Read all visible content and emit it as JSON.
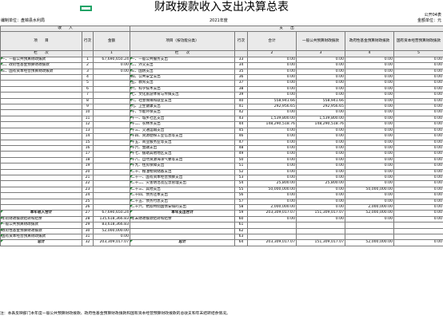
{
  "title": "财政拨款收入支出决算总表",
  "meta": {
    "unit_left": "编制单位：",
    "unit_name": "盘锦县水利局",
    "year": "2021年度",
    "form_no": "公开04表",
    "unit_right": "金额单位：元"
  },
  "headers": {
    "income": "收　　入",
    "expense": "支　　出",
    "item": "项　　目",
    "row_no": "行次",
    "amount": "金额",
    "item_by_function": "项目（按功能分类）",
    "total": "合计",
    "general_budget": "一般公共预算财政拨款",
    "gov_fund": "政府性基金预算财政拨款",
    "state_capital": "国有资本经营预算财政拨款",
    "lan_ci": "栏　　次",
    "col_nums": [
      "1",
      "2",
      "3",
      "4",
      "5"
    ]
  },
  "rows": [
    {
      "ln": "一、一般公共预算财政拨款",
      "li": "1",
      "la": "67,690,650.24",
      "rn": "一、一般公共服务支出",
      "ri": "33",
      "t": "0.00",
      "g": "0.00",
      "f": "0.00",
      "s": "0.00"
    },
    {
      "ln": "二、政府性基金预算财政拨款",
      "li": "2",
      "la": "0.00",
      "rn": "二、外交支出",
      "ri": "34",
      "t": "0.00",
      "g": "0.00",
      "f": "0.00",
      "s": "0.00"
    },
    {
      "ln": "三、国有资本经营预算财政拨款",
      "li": "3",
      "la": "0.00",
      "rn": "三、国防支出",
      "ri": "35",
      "t": "0.00",
      "g": "0.00",
      "f": "0.00",
      "s": "0.00"
    },
    {
      "ln": "",
      "li": "4",
      "la": "",
      "rn": "四、公共安全支出",
      "ri": "36",
      "t": "0.00",
      "g": "0.00",
      "f": "0.00",
      "s": "0.00"
    },
    {
      "ln": "",
      "li": "5",
      "la": "",
      "rn": "五、教育支出",
      "ri": "37",
      "t": "0.00",
      "g": "0.00",
      "f": "0.00",
      "s": "0.00"
    },
    {
      "ln": "",
      "li": "6",
      "la": "",
      "rn": "六、科学技术支出",
      "ri": "38",
      "t": "0.00",
      "g": "0.00",
      "f": "0.00",
      "s": "0.00"
    },
    {
      "ln": "",
      "li": "7",
      "la": "",
      "rn": "七、文化旅游体育与传媒支出",
      "ri": "39",
      "t": "0.00",
      "g": "0.00",
      "f": "0.00",
      "s": "0.00"
    },
    {
      "ln": "",
      "li": "8",
      "la": "",
      "rn": "八、社会保障和就业支出",
      "ri": "40",
      "t": "558,941.66",
      "g": "558,941.66",
      "f": "0.00",
      "s": "0.00"
    },
    {
      "ln": "",
      "li": "9",
      "la": "",
      "rn": "九、卫生健康支出",
      "ri": "41",
      "t": "292,956.65",
      "g": "292,956.65",
      "f": "0.00",
      "s": "0.00"
    },
    {
      "ln": "",
      "li": "10",
      "la": "",
      "rn": "十、节能环保支出",
      "ri": "42",
      "t": "0.00",
      "g": "0.00",
      "f": "0.00",
      "s": "0.00"
    },
    {
      "ln": "",
      "li": "11",
      "la": "",
      "rn": "十一、城乡社区支出",
      "ri": "43",
      "t": "1,539,800.00",
      "g": "1,539,800.00",
      "f": "0.00",
      "s": "0.00"
    },
    {
      "ln": "",
      "li": "12",
      "la": "",
      "rn": "十二、农林水支出",
      "ri": "44",
      "t": "148,290,518.76",
      "g": "148,290,518.76",
      "f": "0.00",
      "s": "0.00"
    },
    {
      "ln": "",
      "li": "13",
      "la": "",
      "rn": "十三、交通运输支出",
      "ri": "45",
      "t": "0.00",
      "g": "0.00",
      "f": "0.00",
      "s": "0.00"
    },
    {
      "ln": "",
      "li": "14",
      "la": "",
      "rn": "十四、资源勘探工业信息等支出",
      "ri": "46",
      "t": "0.00",
      "g": "0.00",
      "f": "0.00",
      "s": "0.00"
    },
    {
      "ln": "",
      "li": "15",
      "la": "",
      "rn": "十五、商业服务业等支出",
      "ri": "47",
      "t": "0.00",
      "g": "0.00",
      "f": "0.00",
      "s": "0.00"
    },
    {
      "ln": "",
      "li": "16",
      "la": "",
      "rn": "十六、金融支出",
      "ri": "48",
      "t": "0.00",
      "g": "0.00",
      "f": "0.00",
      "s": "0.00"
    },
    {
      "ln": "",
      "li": "17",
      "la": "",
      "rn": "十七、援助其他地区支出",
      "ri": "49",
      "t": "0.00",
      "g": "0.00",
      "f": "0.00",
      "s": "0.00"
    },
    {
      "ln": "",
      "li": "18",
      "la": "",
      "rn": "十八、自然资源海洋气象等支出",
      "ri": "50",
      "t": "0.00",
      "g": "0.00",
      "f": "0.00",
      "s": "0.00"
    },
    {
      "ln": "",
      "li": "19",
      "la": "",
      "rn": "十九、住房保障支出",
      "ri": "51",
      "t": "0.00",
      "g": "0.00",
      "f": "0.00",
      "s": "0.00"
    },
    {
      "ln": "",
      "li": "20",
      "la": "",
      "rn": "二十、粮油物资储备支出",
      "ri": "52",
      "t": "0.00",
      "g": "0.00",
      "f": "0.00",
      "s": "0.00"
    },
    {
      "ln": "",
      "li": "21",
      "la": "",
      "rn": "二十一、国有资本经营预算支出",
      "ri": "53",
      "t": "0.00",
      "g": "0.00",
      "f": "0.00",
      "s": "0.00"
    },
    {
      "ln": "",
      "li": "22",
      "la": "",
      "rn": "二十二、灾害防治及应急管理支出",
      "ri": "54",
      "t": "25,800.00",
      "g": "25,800.00",
      "f": "0.00",
      "s": "0.00"
    },
    {
      "ln": "",
      "li": "23",
      "la": "",
      "rn": "二十三、其他支出",
      "ri": "55",
      "t": "50,000,000.00",
      "g": "0.00",
      "f": "50,000,000.00",
      "s": "0.00"
    },
    {
      "ln": "",
      "li": "24",
      "la": "",
      "rn": "二十四、债务还本支出",
      "ri": "56",
      "t": "0.00",
      "g": "0.00",
      "f": "0.00",
      "s": "0.00"
    },
    {
      "ln": "",
      "li": "25",
      "la": "",
      "rn": "二十五、债务付息支出",
      "ri": "57",
      "t": "0.00",
      "g": "0.00",
      "f": "0.00",
      "s": "0.00"
    },
    {
      "ln": "",
      "li": "26",
      "la": "",
      "rn": "二十六、抗疫特别国债安排的支出",
      "ri": "58",
      "t": "2,000,000.00",
      "g": "0.00",
      "f": "2,000,000.00",
      "s": "0.00"
    }
  ],
  "summary_rows": [
    {
      "ln": "本年收入合计",
      "li": "27",
      "la": "67,690,650.24",
      "rn": "本年支出合计",
      "ri": "59",
      "t": "203,309,017.07",
      "g": "151,309,017.07",
      "f": "52,000,000.00",
      "s": "0.00",
      "bold": true
    },
    {
      "ln": "年初财政拨款结转和结余",
      "li": "28",
      "la": "135,618,366.83",
      "rn": "年末财政拨款结转和结余",
      "ri": "60",
      "t": "0.00",
      "g": "0.00",
      "f": "0.00",
      "s": "0.00",
      "bold": false
    },
    {
      "ln": "一般公共预算财政拨款",
      "li": "29",
      "la": "83,618,366.83",
      "rn": "",
      "ri": "61",
      "t": "",
      "g": "",
      "f": "",
      "s": "",
      "bold": false
    },
    {
      "ln": "政府性基金预算财政拨款",
      "li": "30",
      "la": "52,000,000.00",
      "rn": "",
      "ri": "62",
      "t": "",
      "g": "",
      "f": "",
      "s": "",
      "bold": false
    },
    {
      "ln": "国有资本经营预算财政拨款",
      "li": "31",
      "la": "0.00",
      "rn": "",
      "ri": "63",
      "t": "",
      "g": "",
      "f": "",
      "s": "",
      "bold": false
    },
    {
      "ln": "总计",
      "li": "32",
      "la": "203,309,017.07",
      "rn": "总计",
      "ri": "64",
      "t": "203,309,017.07",
      "g": "151,309,017.07",
      "f": "52,000,000.00",
      "s": "0.00",
      "bold": true
    }
  ],
  "footnote": "注：本表反映部门本年度一般公共预算财政拨款、政府性基金预算财政拨款和国有资本经营预算财政拨款的总收支和年末结转结余情况。"
}
